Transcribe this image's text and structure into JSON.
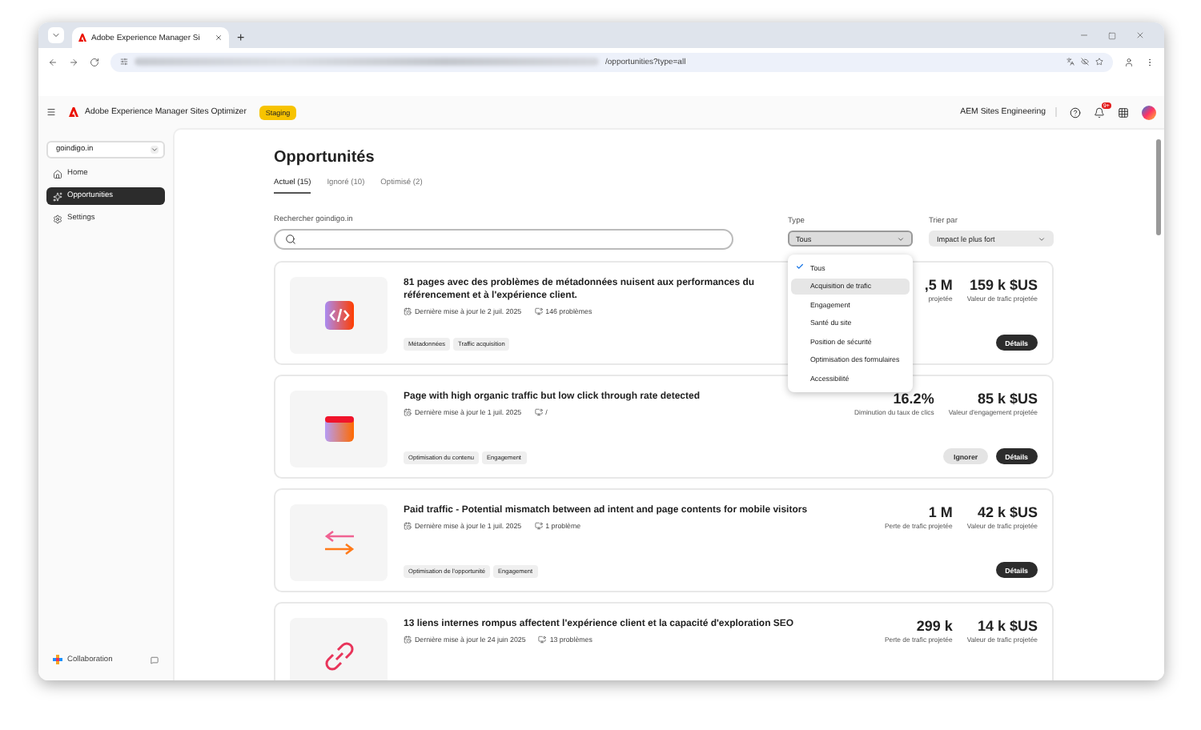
{
  "browser": {
    "tab_title": "Adobe Experience Manager Si",
    "new_tab": "+",
    "url": "/opportunities?type=all"
  },
  "header": {
    "title": "Adobe Experience Manager Sites Optimizer",
    "badge": "Staging",
    "org": "AEM Sites Engineering",
    "notifications": "9+"
  },
  "sidebar": {
    "site": "goindigo.in",
    "items": [
      {
        "label": "Home",
        "kind": "home",
        "selected": false
      },
      {
        "label": "Opportunities",
        "kind": "opportunities",
        "selected": true
      },
      {
        "label": "Settings",
        "kind": "settings",
        "selected": false
      }
    ],
    "footer": "Collaboration"
  },
  "main": {
    "title": "Opportunités",
    "tabs": [
      {
        "label": "Actuel (15)",
        "selected": true
      },
      {
        "label": "Ignoré (10)",
        "selected": false
      },
      {
        "label": "Optimisé (2)",
        "selected": false
      }
    ],
    "search": {
      "label": "Rechercher goindigo.in"
    },
    "type_filter": {
      "label": "Type",
      "value": "Tous",
      "expanded": true,
      "options": [
        {
          "label": "Tous",
          "selected": true,
          "highlighted": false
        },
        {
          "label": "Acquisition de trafic",
          "selected": false,
          "highlighted": true
        },
        {
          "label": "Engagement",
          "selected": false,
          "highlighted": false
        },
        {
          "label": "Santé du site",
          "selected": false,
          "highlighted": false
        },
        {
          "label": "Position de sécurité",
          "selected": false,
          "highlighted": false
        },
        {
          "label": "Optimisation des formulaires",
          "selected": false,
          "highlighted": false
        },
        {
          "label": "Accessibilité",
          "selected": false,
          "highlighted": false
        }
      ]
    },
    "sort_filter": {
      "label": "Trier par",
      "value": "Impact le plus fort"
    },
    "cards": [
      {
        "kind": "code",
        "title": "81 pages avec des problèmes de métadonnées nuisent aux performances du référencement et à l'expérience client.",
        "updated": "Dernière mise à jour le 2 juil. 2025",
        "issues": "146 problèmes",
        "tags": [
          "Métadonnées",
          "Traffic acquisition"
        ],
        "metrics": [
          {
            "value": ",5 M",
            "label": "projetée"
          },
          {
            "value": "159 k $US",
            "label": "Valeur de trafic projetée"
          }
        ],
        "buttons": [
          {
            "kind": "primary",
            "label": "Détails"
          }
        ]
      },
      {
        "kind": "browser",
        "title": "Page with high organic traffic but low click through rate detected",
        "updated": "Dernière mise à jour le 1 juil. 2025",
        "issues": "/",
        "tags": [
          "Optimisation du contenu",
          "Engagement"
        ],
        "metrics": [
          {
            "value": "16.2%",
            "label": "Diminution du taux de clics"
          },
          {
            "value": "85 k $US",
            "label": "Valeur d'engagement projetée"
          }
        ],
        "buttons": [
          {
            "kind": "secondary",
            "label": "Ignorer"
          },
          {
            "kind": "primary",
            "label": "Détails"
          }
        ]
      },
      {
        "kind": "arrows",
        "title": "Paid traffic - Potential mismatch between ad intent and page contents for mobile visitors",
        "updated": "Dernière mise à jour le 1 juil. 2025",
        "issues": "1 problème",
        "tags": [
          "Optimisation de l'opportunité",
          "Engagement"
        ],
        "metrics": [
          {
            "value": "1 M",
            "label": "Perte de trafic projetée"
          },
          {
            "value": "42 k $US",
            "label": "Valeur de trafic projetée"
          }
        ],
        "buttons": [
          {
            "kind": "primary",
            "label": "Détails"
          }
        ]
      },
      {
        "kind": "link",
        "title": "13 liens internes rompus affectent l'expérience client et la capacité d'exploration SEO",
        "updated": "Dernière mise à jour le 24 juin 2025",
        "issues": "13 problèmes",
        "metrics": [
          {
            "value": "299 k",
            "label": "Perte de trafic projetée"
          },
          {
            "value": "14 k $US",
            "label": "Valeur de trafic projetée"
          }
        ]
      }
    ]
  }
}
